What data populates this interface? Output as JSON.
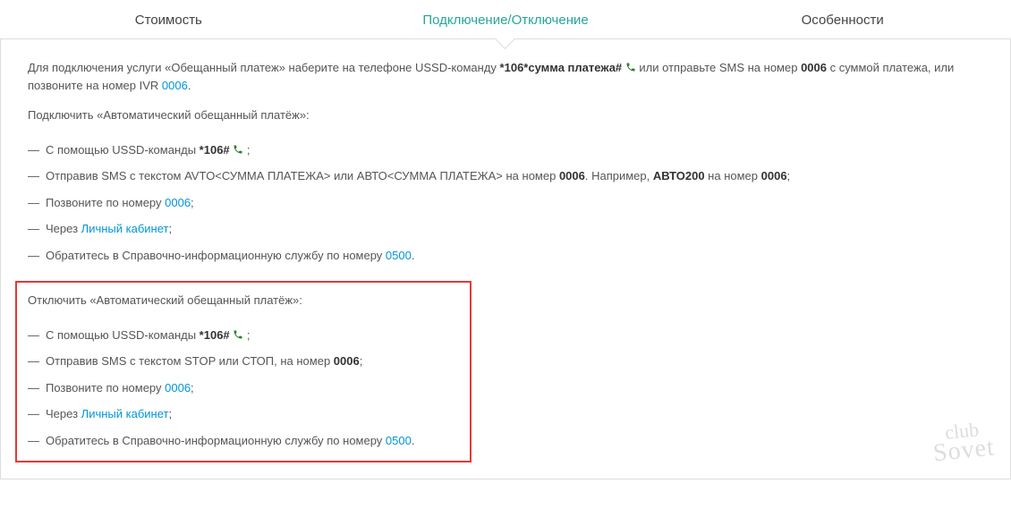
{
  "tabs": {
    "cost": "Стоимость",
    "connect": "Подключение/Отключение",
    "features": "Особенности"
  },
  "intro": {
    "p1a": "Для подключения услуги «Обещанный платеж» наберите на телефоне USSD-команду ",
    "ussd1": " *106*сумма платежа#",
    "p1b": "  или отправьте SMS на номер ",
    "num1": "0006",
    "p1c": " с суммой платежа, или позвоните на номер IVR ",
    "ivr": "0006",
    "p1d": "."
  },
  "connect": {
    "title": "Подключить «Автоматический обещанный платёж»:",
    "i1a": "С помощью USSD-команды ",
    "i1code": " *106#",
    "i1b": " ;",
    "i2a": "Отправив SMS с текстом AVTO<СУММА ПЛАТЕЖА> или АВТО<СУММА ПЛАТЕЖА> на номер ",
    "i2n1": "0006",
    "i2b": ". Например, ",
    "i2ex": "АВТО200",
    "i2c": " на номер ",
    "i2n2": "0006",
    "i2d": ";",
    "i3a": "Позвоните по номеру ",
    "i3link": "0006",
    "i3b": ";",
    "i4a": "Через ",
    "i4link": "Личный кабинет",
    "i4b": ";",
    "i5a": "Обратитесь в Справочно-информационную службу по номеру ",
    "i5link": "0500",
    "i5b": "."
  },
  "disconnect": {
    "title": "Отключить «Автоматический обещанный платёж»:",
    "i1a": "С помощью USSD-команды ",
    "i1code": " *106#",
    "i1b": " ;",
    "i2a": "Отправив SMS с текстом STOP или СТОП, на номер ",
    "i2n": "0006",
    "i2b": ";",
    "i3a": "Позвоните по номеру ",
    "i3link": "0006",
    "i3b": ";",
    "i4a": "Через ",
    "i4link": "Личный кабинет",
    "i4b": ";",
    "i5a": "Обратитесь в Справочно-информационную службу по номеру ",
    "i5link": "0500",
    "i5b": "."
  },
  "watermark": {
    "l1": "club",
    "l2": "Sovet"
  }
}
